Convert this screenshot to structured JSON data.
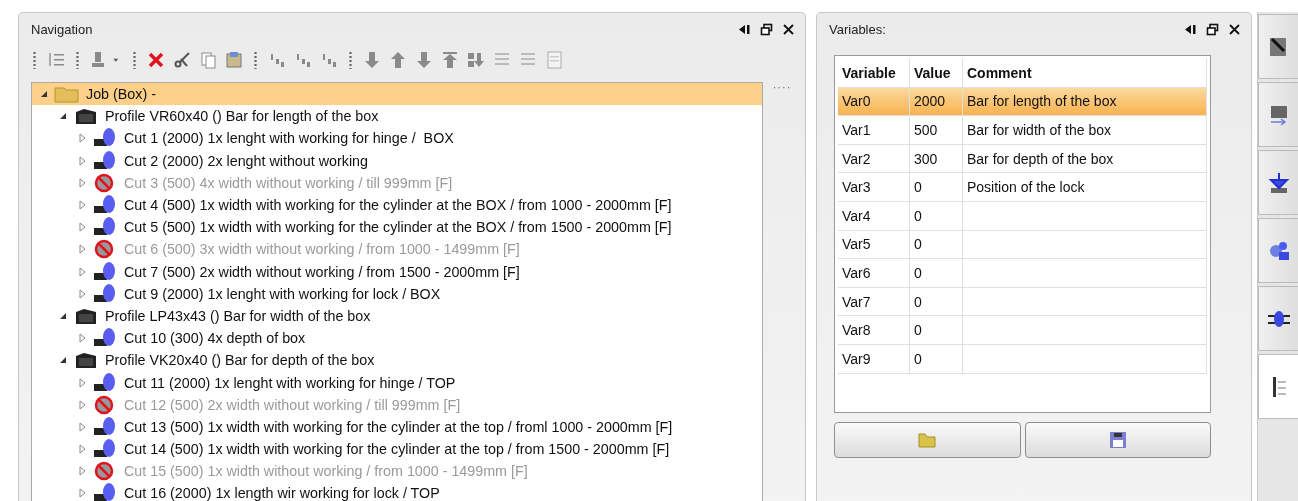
{
  "navigation": {
    "title": "Navigation",
    "tree": [
      {
        "kind": "job",
        "label": "Job (Box) -",
        "expanded": true,
        "selected": true,
        "children": [
          {
            "kind": "profile",
            "label": "Profile VR60x40 () Bar for length of the box",
            "expanded": true,
            "selected": false,
            "children": [
              {
                "kind": "cut",
                "label": "Cut 1 (2000) 1x lenght with working for hinge /  BOX",
                "expanded": false,
                "disabled": false
              },
              {
                "kind": "cut",
                "label": "Cut 2 (2000) 2x lenght without working",
                "expanded": false,
                "disabled": false
              },
              {
                "kind": "cut",
                "label": "Cut 3 (500) 4x width without working / till 999mm [F]",
                "expanded": false,
                "disabled": true
              },
              {
                "kind": "cut",
                "label": "Cut 4 (500) 1x width with working for the cylinder at the BOX / from 1000 - 2000mm [F]",
                "expanded": false,
                "disabled": false
              },
              {
                "kind": "cut",
                "label": "Cut 5 (500) 1x width with working for the cylinder at the BOX / from 1500 - 2000mm [F]",
                "expanded": false,
                "disabled": false
              },
              {
                "kind": "cut",
                "label": "Cut 6 (500) 3x width without working / from 1000 - 1499mm [F]",
                "expanded": false,
                "disabled": true
              },
              {
                "kind": "cut",
                "label": "Cut 7 (500) 2x width without working / from 1500 - 2000mm [F]",
                "expanded": false,
                "disabled": false
              },
              {
                "kind": "cut",
                "label": "Cut 9 (2000) 1x lenght with working for lock / BOX",
                "expanded": false,
                "disabled": false
              }
            ]
          },
          {
            "kind": "profile",
            "label": "Profile LP43x43 () Bar for width of the box",
            "expanded": true,
            "selected": false,
            "children": [
              {
                "kind": "cut",
                "label": "Cut 10 (300) 4x depth of box",
                "expanded": false,
                "disabled": false
              }
            ]
          },
          {
            "kind": "profile",
            "label": "Profile VK20x40 () Bar for depth of the box",
            "expanded": true,
            "selected": false,
            "children": [
              {
                "kind": "cut",
                "label": "Cut 11 (2000) 1x lenght with working for hinge / TOP",
                "expanded": false,
                "disabled": false
              },
              {
                "kind": "cut",
                "label": "Cut 12 (500) 2x width without working / till 999mm [F]",
                "expanded": false,
                "disabled": true
              },
              {
                "kind": "cut",
                "label": "Cut 13 (500) 1x width with working for the cylinder at the top / froml 1000 - 2000mm [F]",
                "expanded": false,
                "disabled": false
              },
              {
                "kind": "cut",
                "label": "Cut 14 (500) 1x width with working for the cylinder at the top / from 1500 - 2000mm [F]",
                "expanded": false,
                "disabled": false
              },
              {
                "kind": "cut",
                "label": "Cut 15 (500) 1x width without working / from 1000 - 1499mm [F]",
                "expanded": false,
                "disabled": true
              },
              {
                "kind": "cut",
                "label": "Cut 16 (2000) 1x length wir working for lock / TOP",
                "expanded": false,
                "disabled": false
              }
            ]
          }
        ]
      }
    ],
    "side_handle": "····"
  },
  "variables": {
    "title": "Variables:",
    "columns": [
      "Variable",
      "Value",
      "Comment"
    ],
    "rows": [
      {
        "cells": [
          "Var0",
          "2000",
          "Bar for length of the box"
        ],
        "selected": true
      },
      {
        "cells": [
          "Var1",
          "500",
          "Bar for width of the box"
        ],
        "selected": false
      },
      {
        "cells": [
          "Var2",
          "300",
          "Bar for depth of the box"
        ],
        "selected": false
      },
      {
        "cells": [
          "Var3",
          "0",
          "Position of the lock"
        ],
        "selected": false
      },
      {
        "cells": [
          "Var4",
          "0",
          ""
        ],
        "selected": false
      },
      {
        "cells": [
          "Var5",
          "0",
          ""
        ],
        "selected": false
      },
      {
        "cells": [
          "Var6",
          "0",
          ""
        ],
        "selected": false
      },
      {
        "cells": [
          "Var7",
          "0",
          ""
        ],
        "selected": false
      },
      {
        "cells": [
          "Var8",
          "0",
          ""
        ],
        "selected": false
      },
      {
        "cells": [
          "Var9",
          "0",
          ""
        ],
        "selected": false
      }
    ]
  },
  "side_tabs": [
    {
      "kind": "wand",
      "selected": false
    },
    {
      "kind": "import",
      "selected": false
    },
    {
      "kind": "download",
      "selected": false
    },
    {
      "kind": "gears",
      "selected": false
    },
    {
      "kind": "screw",
      "selected": false
    },
    {
      "kind": "list",
      "selected": true
    }
  ]
}
